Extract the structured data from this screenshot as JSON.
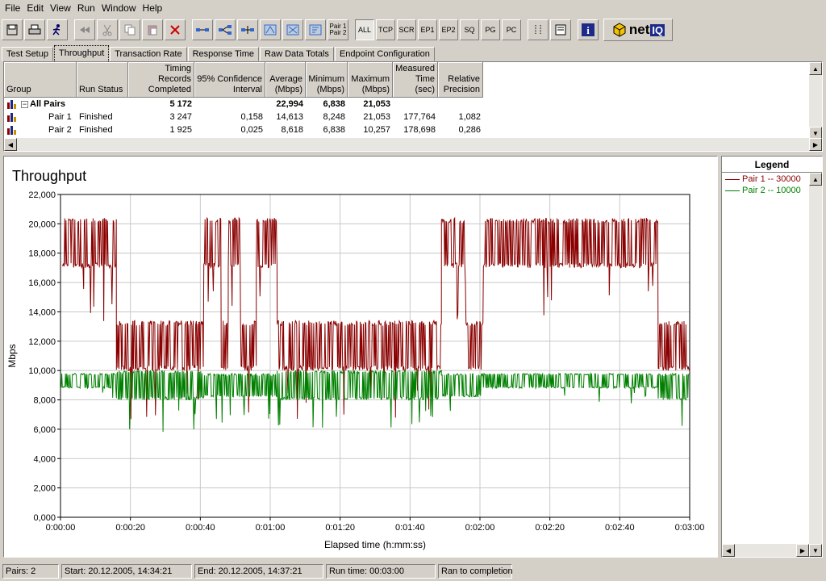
{
  "menu": [
    "File",
    "Edit",
    "View",
    "Run",
    "Window",
    "Help"
  ],
  "toolbar": {
    "text_buttons": [
      "ALL",
      "TCP",
      "SCR",
      "EP1",
      "EP2",
      "SQ",
      "PG",
      "PC"
    ],
    "pair_button_line1": "Pair 1",
    "pair_button_line2": "Pair 2",
    "logo_text": "net",
    "logo_iq": "IQ"
  },
  "tabs": [
    "Test Setup",
    "Throughput",
    "Transaction Rate",
    "Response Time",
    "Raw Data Totals",
    "Endpoint Configuration"
  ],
  "grid": {
    "headers": [
      {
        "l1": "",
        "l2": "Group"
      },
      {
        "l1": "",
        "l2": "Run Status"
      },
      {
        "l1": "Timing Records",
        "l2": "Completed"
      },
      {
        "l1": "95% Confidence",
        "l2": "Interval"
      },
      {
        "l1": "Average",
        "l2": "(Mbps)"
      },
      {
        "l1": "Minimum",
        "l2": "(Mbps)"
      },
      {
        "l1": "Maximum",
        "l2": "(Mbps)"
      },
      {
        "l1": "Measured",
        "l2": "Time (sec)"
      },
      {
        "l1": "Relative",
        "l2": "Precision"
      }
    ],
    "rows": [
      [
        "All Pairs",
        "",
        "5 172",
        "",
        "22,994",
        "6,838",
        "21,053",
        "",
        ""
      ],
      [
        "Pair 1",
        "Finished",
        "3 247",
        "0,158",
        "14,613",
        "8,248",
        "21,053",
        "177,764",
        "1,082"
      ],
      [
        "Pair 2",
        "Finished",
        "1 925",
        "0,025",
        "8,618",
        "6,838",
        "10,257",
        "178,698",
        "0,286"
      ]
    ]
  },
  "chart_data": {
    "type": "line",
    "title": "Throughput",
    "xlabel": "Elapsed time (h:mm:ss)",
    "ylabel": "Mbps",
    "xlim": [
      0,
      180
    ],
    "ylim": [
      0,
      22000
    ],
    "x_ticks": [
      "0:00:00",
      "0:00:20",
      "0:00:40",
      "0:01:00",
      "0:01:20",
      "0:01:40",
      "0:02:00",
      "0:02:20",
      "0:02:40",
      "0:03:00"
    ],
    "y_ticks": [
      "0,000",
      "2,000",
      "4,000",
      "6,000",
      "8,000",
      "10,000",
      "12,000",
      "14,000",
      "16,000",
      "18,000",
      "20,000",
      "22,000"
    ],
    "grid": true,
    "series": [
      {
        "name": "Pair 1 -- 30000",
        "color": "#8b0000",
        "segments": [
          {
            "start": 0.5,
            "end": 16,
            "low": 17000,
            "high": 20400
          },
          {
            "start": 16,
            "end": 41,
            "low": 10000,
            "high": 13400
          },
          {
            "start": 41,
            "end": 46,
            "low": 17000,
            "high": 20400
          },
          {
            "start": 46,
            "end": 48,
            "low": 10000,
            "high": 13400
          },
          {
            "start": 48,
            "end": 51.5,
            "low": 17000,
            "high": 20400
          },
          {
            "start": 51.5,
            "end": 56,
            "low": 10000,
            "high": 13400
          },
          {
            "start": 56,
            "end": 62,
            "low": 17000,
            "high": 20400
          },
          {
            "start": 62,
            "end": 109,
            "low": 10000,
            "high": 13400
          },
          {
            "start": 109,
            "end": 116,
            "low": 17000,
            "high": 20400
          },
          {
            "start": 116,
            "end": 121,
            "low": 10000,
            "high": 13400
          },
          {
            "start": 121,
            "end": 171,
            "low": 17000,
            "high": 20400
          },
          {
            "start": 171,
            "end": 180,
            "low": 10000,
            "high": 13400
          }
        ]
      },
      {
        "name": "Pair 2 -- 10000",
        "color": "#008000",
        "segments": [
          {
            "start": 0,
            "end": 16,
            "low": 8800,
            "high": 9800
          },
          {
            "start": 16,
            "end": 41,
            "low": 8000,
            "high": 10000
          },
          {
            "start": 41,
            "end": 62,
            "low": 8200,
            "high": 9800
          },
          {
            "start": 62,
            "end": 109,
            "low": 8000,
            "high": 10000
          },
          {
            "start": 109,
            "end": 121,
            "low": 8200,
            "high": 9800
          },
          {
            "start": 121,
            "end": 171,
            "low": 8800,
            "high": 9800
          },
          {
            "start": 171,
            "end": 180,
            "low": 8000,
            "high": 9800
          }
        ]
      }
    ]
  },
  "legend": {
    "title": "Legend",
    "items": [
      "Pair 1 -- 30000",
      "Pair 2 -- 10000"
    ]
  },
  "statusbar": {
    "pairs": "Pairs: 2",
    "start": "Start: 20.12.2005, 14:34:21",
    "end": "End: 20.12.2005, 14:37:21",
    "runtime": "Run time: 00:03:00",
    "status": "Ran to completion"
  }
}
